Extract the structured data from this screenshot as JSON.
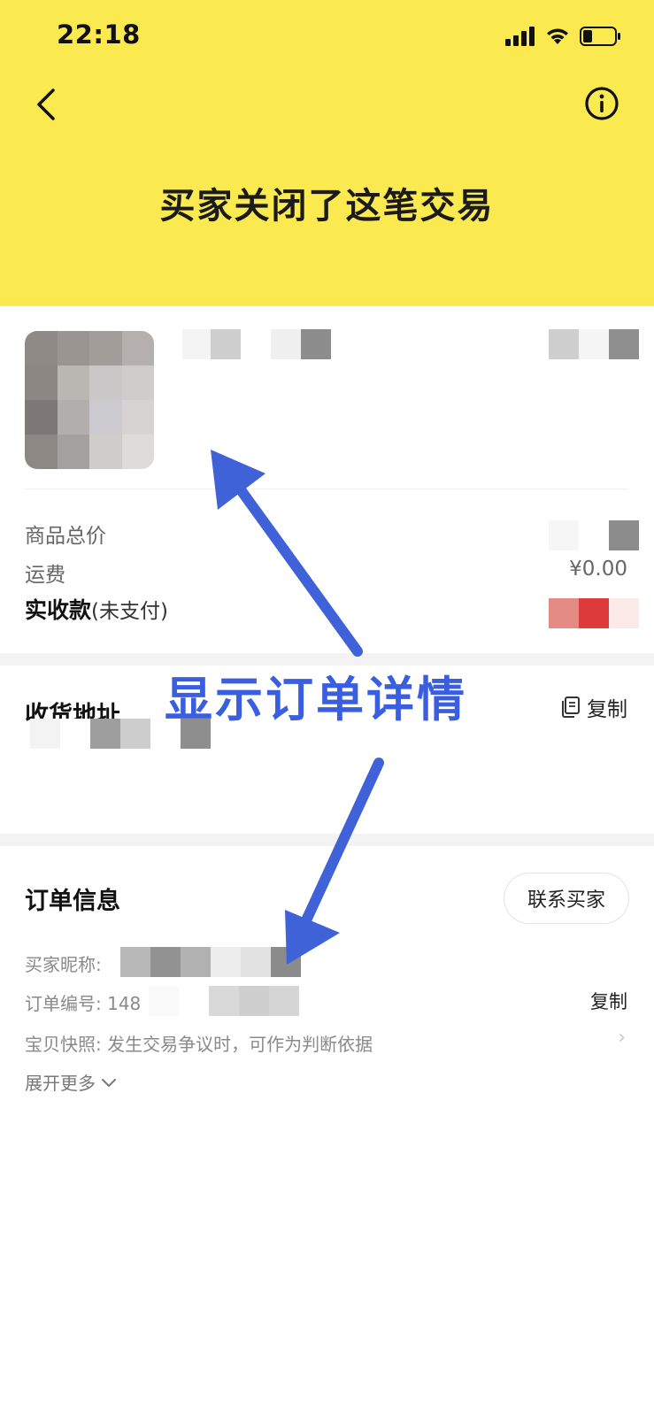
{
  "status_bar": {
    "time": "22:18"
  },
  "header": {
    "title": "买家关闭了这笔交易",
    "background_color": "#fae94f"
  },
  "price": {
    "goods_total_label": "商品总价",
    "shipping_label": "运费",
    "shipping_value": "¥0.00",
    "paid_label": "实收款",
    "paid_sub": "(未支付)"
  },
  "address": {
    "title": "收货地址",
    "copy_label": "复制"
  },
  "order": {
    "title": "订单信息",
    "contact_buyer_label": "联系买家",
    "buyer_nick_label": "买家昵称:",
    "order_no_label": "订单编号:",
    "order_no_prefix": "148",
    "order_no_copy": "复制",
    "snapshot_label": "宝贝快照:",
    "snapshot_desc": "发生交易争议时，可作为判断依据",
    "expand_label": "展开更多"
  },
  "annotation": {
    "text": "显示订单详情",
    "color": "#3a5ee0"
  }
}
